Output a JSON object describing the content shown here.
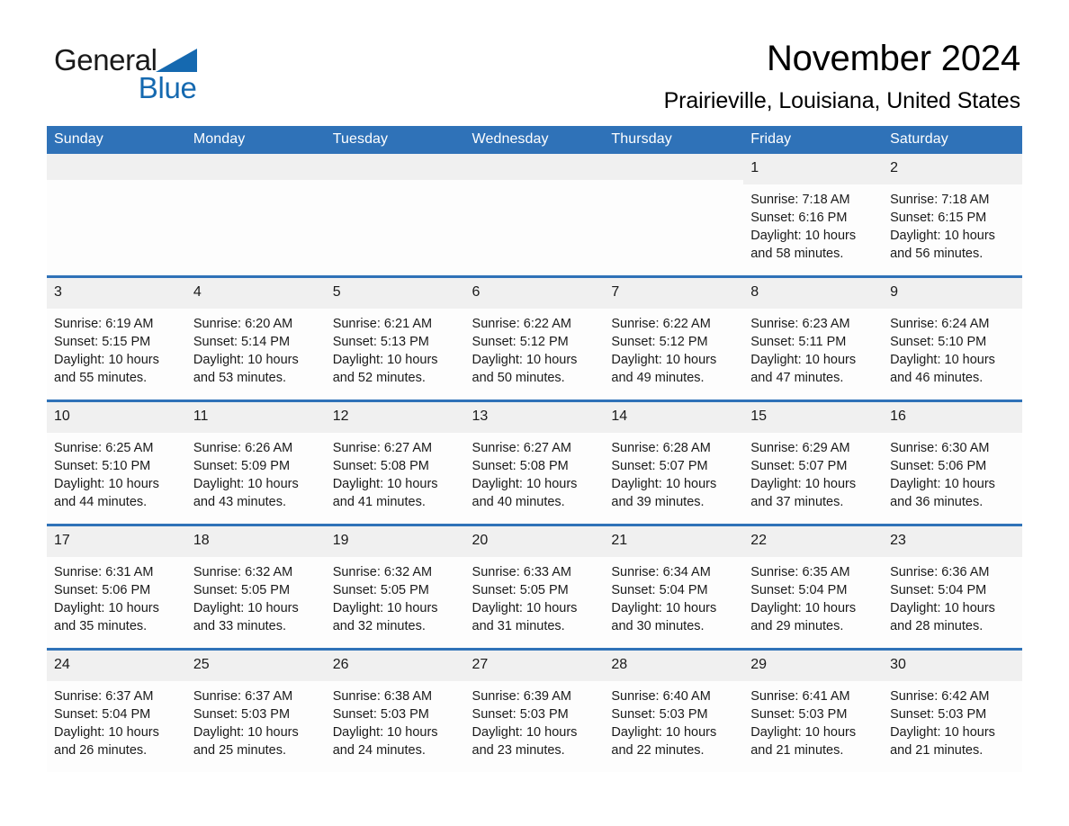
{
  "brand": {
    "name_part1": "General",
    "name_part2": "Blue",
    "triangle_color": "#1569b0",
    "icon": "triangle-logo-icon"
  },
  "header": {
    "title": "November 2024",
    "subtitle": "Prairieville, Louisiana, United States"
  },
  "theme": {
    "header_bar_color": "#2f72b8",
    "day_band_color": "#f0f0f0",
    "row_divider_color": "#2f72b8",
    "text_color": "#1a1a1a"
  },
  "calendar": {
    "weekday_headers": [
      "Sunday",
      "Monday",
      "Tuesday",
      "Wednesday",
      "Thursday",
      "Friday",
      "Saturday"
    ],
    "weeks": [
      [
        {
          "day": "",
          "info": ""
        },
        {
          "day": "",
          "info": ""
        },
        {
          "day": "",
          "info": ""
        },
        {
          "day": "",
          "info": ""
        },
        {
          "day": "",
          "info": ""
        },
        {
          "day": "1",
          "info": "Sunrise: 7:18 AM\nSunset: 6:16 PM\nDaylight: 10 hours and 58 minutes."
        },
        {
          "day": "2",
          "info": "Sunrise: 7:18 AM\nSunset: 6:15 PM\nDaylight: 10 hours and 56 minutes."
        }
      ],
      [
        {
          "day": "3",
          "info": "Sunrise: 6:19 AM\nSunset: 5:15 PM\nDaylight: 10 hours and 55 minutes."
        },
        {
          "day": "4",
          "info": "Sunrise: 6:20 AM\nSunset: 5:14 PM\nDaylight: 10 hours and 53 minutes."
        },
        {
          "day": "5",
          "info": "Sunrise: 6:21 AM\nSunset: 5:13 PM\nDaylight: 10 hours and 52 minutes."
        },
        {
          "day": "6",
          "info": "Sunrise: 6:22 AM\nSunset: 5:12 PM\nDaylight: 10 hours and 50 minutes."
        },
        {
          "day": "7",
          "info": "Sunrise: 6:22 AM\nSunset: 5:12 PM\nDaylight: 10 hours and 49 minutes."
        },
        {
          "day": "8",
          "info": "Sunrise: 6:23 AM\nSunset: 5:11 PM\nDaylight: 10 hours and 47 minutes."
        },
        {
          "day": "9",
          "info": "Sunrise: 6:24 AM\nSunset: 5:10 PM\nDaylight: 10 hours and 46 minutes."
        }
      ],
      [
        {
          "day": "10",
          "info": "Sunrise: 6:25 AM\nSunset: 5:10 PM\nDaylight: 10 hours and 44 minutes."
        },
        {
          "day": "11",
          "info": "Sunrise: 6:26 AM\nSunset: 5:09 PM\nDaylight: 10 hours and 43 minutes."
        },
        {
          "day": "12",
          "info": "Sunrise: 6:27 AM\nSunset: 5:08 PM\nDaylight: 10 hours and 41 minutes."
        },
        {
          "day": "13",
          "info": "Sunrise: 6:27 AM\nSunset: 5:08 PM\nDaylight: 10 hours and 40 minutes."
        },
        {
          "day": "14",
          "info": "Sunrise: 6:28 AM\nSunset: 5:07 PM\nDaylight: 10 hours and 39 minutes."
        },
        {
          "day": "15",
          "info": "Sunrise: 6:29 AM\nSunset: 5:07 PM\nDaylight: 10 hours and 37 minutes."
        },
        {
          "day": "16",
          "info": "Sunrise: 6:30 AM\nSunset: 5:06 PM\nDaylight: 10 hours and 36 minutes."
        }
      ],
      [
        {
          "day": "17",
          "info": "Sunrise: 6:31 AM\nSunset: 5:06 PM\nDaylight: 10 hours and 35 minutes."
        },
        {
          "day": "18",
          "info": "Sunrise: 6:32 AM\nSunset: 5:05 PM\nDaylight: 10 hours and 33 minutes."
        },
        {
          "day": "19",
          "info": "Sunrise: 6:32 AM\nSunset: 5:05 PM\nDaylight: 10 hours and 32 minutes."
        },
        {
          "day": "20",
          "info": "Sunrise: 6:33 AM\nSunset: 5:05 PM\nDaylight: 10 hours and 31 minutes."
        },
        {
          "day": "21",
          "info": "Sunrise: 6:34 AM\nSunset: 5:04 PM\nDaylight: 10 hours and 30 minutes."
        },
        {
          "day": "22",
          "info": "Sunrise: 6:35 AM\nSunset: 5:04 PM\nDaylight: 10 hours and 29 minutes."
        },
        {
          "day": "23",
          "info": "Sunrise: 6:36 AM\nSunset: 5:04 PM\nDaylight: 10 hours and 28 minutes."
        }
      ],
      [
        {
          "day": "24",
          "info": "Sunrise: 6:37 AM\nSunset: 5:04 PM\nDaylight: 10 hours and 26 minutes."
        },
        {
          "day": "25",
          "info": "Sunrise: 6:37 AM\nSunset: 5:03 PM\nDaylight: 10 hours and 25 minutes."
        },
        {
          "day": "26",
          "info": "Sunrise: 6:38 AM\nSunset: 5:03 PM\nDaylight: 10 hours and 24 minutes."
        },
        {
          "day": "27",
          "info": "Sunrise: 6:39 AM\nSunset: 5:03 PM\nDaylight: 10 hours and 23 minutes."
        },
        {
          "day": "28",
          "info": "Sunrise: 6:40 AM\nSunset: 5:03 PM\nDaylight: 10 hours and 22 minutes."
        },
        {
          "day": "29",
          "info": "Sunrise: 6:41 AM\nSunset: 5:03 PM\nDaylight: 10 hours and 21 minutes."
        },
        {
          "day": "30",
          "info": "Sunrise: 6:42 AM\nSunset: 5:03 PM\nDaylight: 10 hours and 21 minutes."
        }
      ]
    ]
  }
}
